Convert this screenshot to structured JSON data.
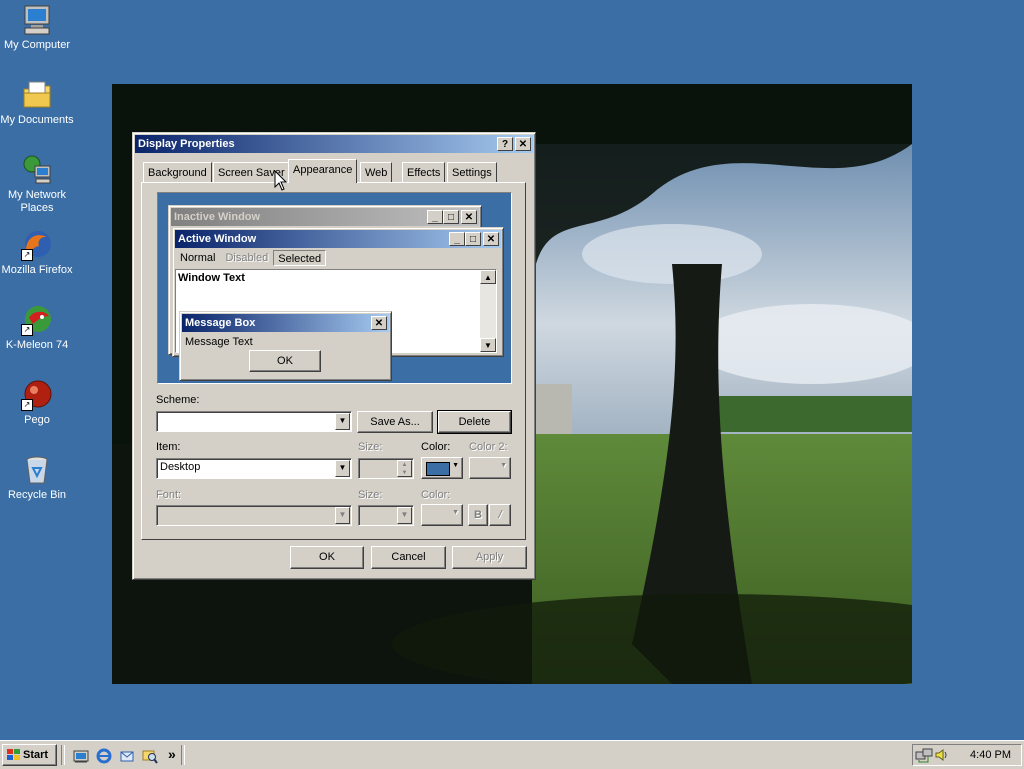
{
  "desktop": {
    "icons": [
      {
        "label": "My Computer",
        "icon": "my-computer-icon"
      },
      {
        "label": "My Documents",
        "icon": "my-documents-icon"
      },
      {
        "label_line1": "My Network",
        "label_line2": "Places",
        "icon": "network-places-icon"
      },
      {
        "label": "Mozilla Firefox",
        "icon": "firefox-icon"
      },
      {
        "label": "K-Meleon 74",
        "icon": "kmeleon-icon"
      },
      {
        "label": "Pego",
        "icon": "pego-icon"
      },
      {
        "label": "Recycle Bin",
        "icon": "recycle-bin-icon"
      }
    ]
  },
  "dialog": {
    "title": "Display Properties",
    "help_glyph": "?",
    "close_glyph": "✕",
    "tabs": [
      {
        "label": "Background"
      },
      {
        "label": "Screen Saver"
      },
      {
        "label": "Appearance",
        "active": true
      },
      {
        "label": "Web"
      },
      {
        "label": "Effects"
      },
      {
        "label": "Settings"
      }
    ],
    "preview": {
      "inactive_title": "Inactive Window",
      "active_title": "Active Window",
      "menu_normal": "Normal",
      "menu_disabled": "Disabled",
      "menu_selected": "Selected",
      "window_text": "Window Text",
      "msgbox_title": "Message Box",
      "msgbox_text": "Message Text",
      "msgbox_ok": "OK"
    },
    "scheme_label": "Scheme:",
    "scheme_value": "",
    "save_as_label": "Save As...",
    "delete_label": "Delete",
    "item_label": "Item:",
    "item_value": "Desktop",
    "size_label": "Size:",
    "color_label": "Color:",
    "color2_label": "Color 2:",
    "desktop_color": "#3a6ea5",
    "font_label": "Font:",
    "font_size_label": "Size:",
    "font_color_label": "Color:",
    "bold_label": "B",
    "italic_label": "/",
    "ok_label": "OK",
    "cancel_label": "Cancel",
    "apply_label": "Apply"
  },
  "taskbar": {
    "start_label": "Start",
    "chevron": "»",
    "clock": "4:40 PM"
  }
}
